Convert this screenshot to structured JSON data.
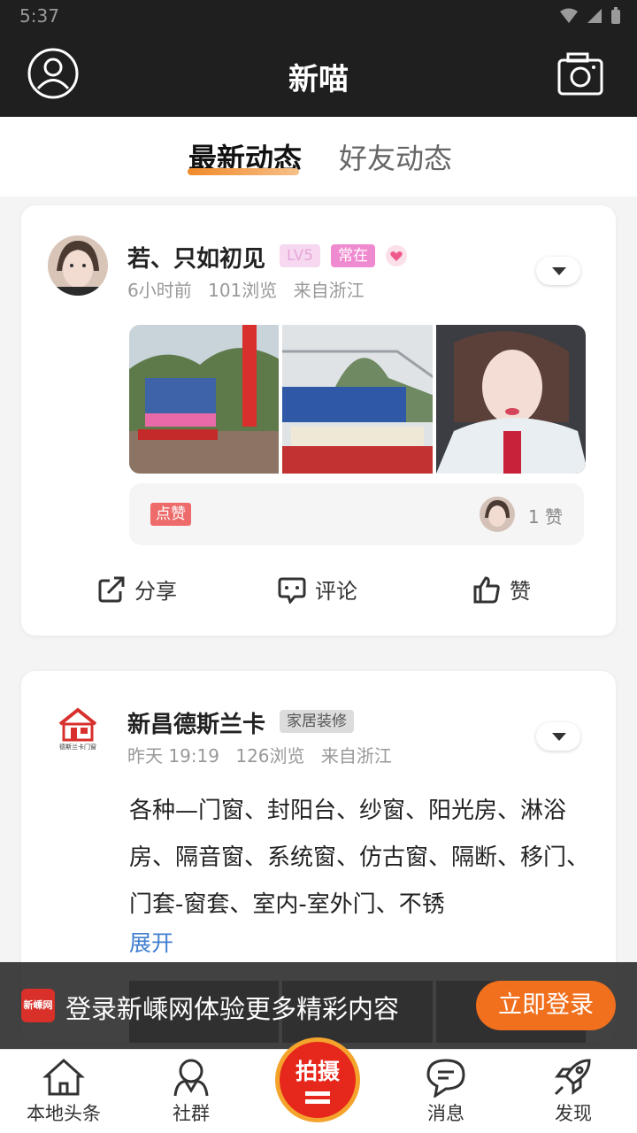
{
  "status_bar": {
    "time": "5:37"
  },
  "header": {
    "title": "新喵"
  },
  "tabs": [
    {
      "label": "最新动态",
      "active": true
    },
    {
      "label": "好友动态",
      "active": false
    }
  ],
  "posts": [
    {
      "user": "若、只如初见",
      "badges": [
        "LV5",
        "常在"
      ],
      "time": "6小时前",
      "views": "101浏览",
      "location": "来自浙江",
      "like_tag": "点赞",
      "like_count": "1 赞",
      "actions": {
        "share": "分享",
        "comment": "评论",
        "like": "赞"
      }
    },
    {
      "user": "新昌德斯兰卡",
      "badge": "家居装修",
      "logo_text": "德斯兰卡门窗",
      "time": "昨天 19:19",
      "views": "126浏览",
      "location": "来自浙江",
      "text": "各种—门窗、封阳台、纱窗、阳光房、淋浴房、隔音窗、系统窗、仿古窗、隔断、移门、门套-窗套、室内-室外门、不锈",
      "expand": "展开"
    }
  ],
  "login_banner": {
    "logo": "新嵊网",
    "text": "登录新嵊网体验更多精彩内容",
    "button": "立即登录"
  },
  "bottom_nav": [
    {
      "label": "本地头条",
      "icon": "home-icon"
    },
    {
      "label": "社群",
      "icon": "community-icon"
    },
    {
      "label": "拍摄",
      "icon": "shoot-icon"
    },
    {
      "label": "消息",
      "icon": "message-icon"
    },
    {
      "label": "发现",
      "icon": "rocket-icon"
    }
  ],
  "colors": {
    "accent": "#f0701e",
    "header_bg": "#1f1f1f",
    "like_tag": "#ee6b6b",
    "link": "#3f7ecf"
  }
}
